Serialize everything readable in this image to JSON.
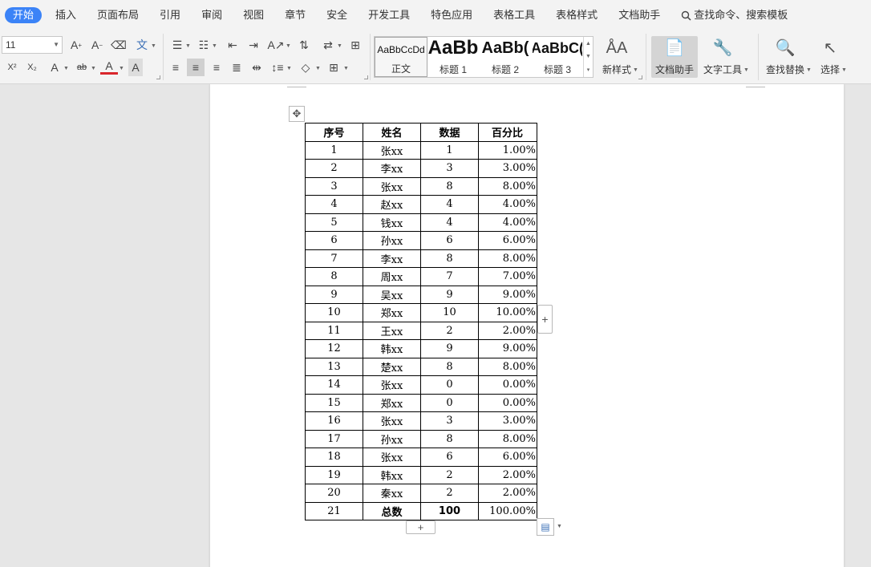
{
  "menu": {
    "tabs": [
      "开始",
      "插入",
      "页面布局",
      "引用",
      "审阅",
      "视图",
      "章节",
      "安全",
      "开发工具",
      "特色应用",
      "表格工具",
      "表格样式",
      "文档助手"
    ],
    "search_label": "查找命令、搜索模板",
    "search_icon": "search-icon"
  },
  "ribbon": {
    "font_size": "11",
    "styles": [
      {
        "sample": "AaBbCcDd",
        "name": "正文"
      },
      {
        "sample": "AaBb",
        "name": "标题 1"
      },
      {
        "sample": "AaBb(",
        "name": "标题 2"
      },
      {
        "sample": "AaBbC(",
        "name": "标题 3"
      }
    ],
    "new_style_label": "新样式",
    "doc_assistant_label": "文档助手",
    "text_tools_label": "文字工具",
    "find_replace_label": "查找替换",
    "select_label": "选择"
  },
  "table": {
    "headers": [
      "序号",
      "姓名",
      "数据",
      "百分比"
    ],
    "rows": [
      [
        "1",
        "张xx",
        "1",
        "1.00%"
      ],
      [
        "2",
        "李xx",
        "3",
        "3.00%"
      ],
      [
        "3",
        "张xx",
        "8",
        "8.00%"
      ],
      [
        "4",
        "赵xx",
        "4",
        "4.00%"
      ],
      [
        "5",
        "钱xx",
        "4",
        "4.00%"
      ],
      [
        "6",
        "孙xx",
        "6",
        "6.00%"
      ],
      [
        "7",
        "李xx",
        "8",
        "8.00%"
      ],
      [
        "8",
        "周xx",
        "7",
        "7.00%"
      ],
      [
        "9",
        "吴xx",
        "9",
        "9.00%"
      ],
      [
        "10",
        "郑xx",
        "10",
        "10.00%"
      ],
      [
        "11",
        "王xx",
        "2",
        "2.00%"
      ],
      [
        "12",
        "韩xx",
        "9",
        "9.00%"
      ],
      [
        "13",
        "楚xx",
        "8",
        "8.00%"
      ],
      [
        "14",
        "张xx",
        "0",
        "0.00%"
      ],
      [
        "15",
        "郑xx",
        "0",
        "0.00%"
      ],
      [
        "16",
        "张xx",
        "3",
        "3.00%"
      ],
      [
        "17",
        "孙xx",
        "8",
        "8.00%"
      ],
      [
        "18",
        "张xx",
        "6",
        "6.00%"
      ],
      [
        "19",
        "韩xx",
        "2",
        "2.00%"
      ],
      [
        "20",
        "秦xx",
        "2",
        "2.00%"
      ]
    ],
    "total_row": [
      "21",
      "总数",
      "100",
      "100.00%"
    ]
  },
  "colors": {
    "active_tab": "#3b83f7",
    "ribbon_bg": "#f3f3f3",
    "doc_bg": "#e6e6e6"
  }
}
